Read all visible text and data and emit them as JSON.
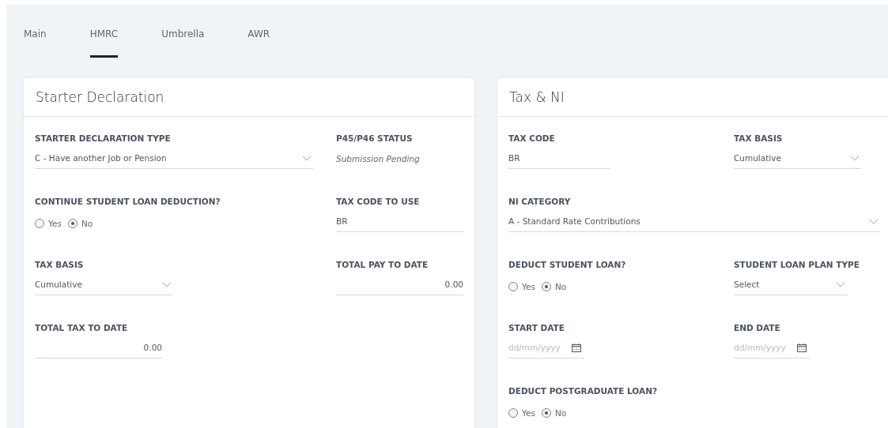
{
  "tabs": [
    {
      "label": "Main",
      "selected": false
    },
    {
      "label": "HMRC",
      "selected": true
    },
    {
      "label": "Umbrella",
      "selected": false
    },
    {
      "label": "AWR",
      "selected": false
    }
  ],
  "cards": [
    {
      "title": "Starter Declaration",
      "rows": [
        [
          {
            "kind": "select",
            "label": "STARTER DECLARATION TYPE",
            "value": "C - Have another Job or Pension"
          },
          {
            "kind": "status",
            "label": "P45/P46 STATUS",
            "value": "Submission Pending"
          }
        ],
        [
          {
            "kind": "radio",
            "label": "CONTINUE STUDENT LOAN DEDUCTION?",
            "options": [
              {
                "label": "Yes",
                "selected": false
              },
              {
                "label": "No",
                "selected": true
              }
            ]
          },
          {
            "kind": "text",
            "label": "TAX CODE TO USE",
            "value": "BR"
          }
        ],
        [
          {
            "kind": "select",
            "label": "TAX BASIS",
            "value": "Cumulative"
          },
          {
            "kind": "number",
            "label": "TOTAL PAY TO DATE",
            "value": "0.00"
          }
        ],
        [
          {
            "kind": "number",
            "label": "TOTAL TAX TO DATE",
            "value": "0.00"
          }
        ]
      ]
    },
    {
      "title": "Tax & NI",
      "rows": [
        [
          {
            "kind": "text",
            "label": "TAX CODE",
            "value": "BR"
          },
          {
            "kind": "select",
            "label": "TAX BASIS",
            "value": "Cumulative"
          }
        ],
        [
          {
            "kind": "select",
            "label": "NI CATEGORY",
            "value": "A - Standard Rate Contributions"
          }
        ],
        [
          {
            "kind": "radio",
            "label": "DEDUCT STUDENT LOAN?",
            "options": [
              {
                "label": "Yes",
                "selected": false
              },
              {
                "label": "No",
                "selected": true
              }
            ]
          },
          {
            "kind": "select",
            "label": "STUDENT LOAN PLAN TYPE",
            "value": "Select"
          }
        ],
        [
          {
            "kind": "date",
            "label": "START DATE",
            "placeholder": "dd/mm/yyyy"
          },
          {
            "kind": "date",
            "label": "END DATE",
            "placeholder": "dd/mm/yyyy"
          }
        ],
        [
          {
            "kind": "radio",
            "label": "DEDUCT POSTGRADUATE LOAN?",
            "options": [
              {
                "label": "Yes",
                "selected": false
              },
              {
                "label": "No",
                "selected": true
              }
            ]
          }
        ]
      ]
    }
  ]
}
